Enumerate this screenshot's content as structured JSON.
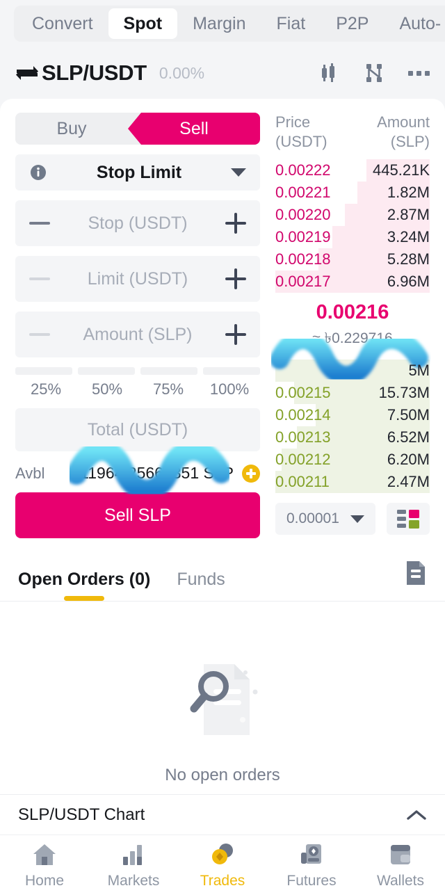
{
  "category_tabs": [
    {
      "label": "Convert",
      "active": false
    },
    {
      "label": "Spot",
      "active": true
    },
    {
      "label": "Margin",
      "active": false
    },
    {
      "label": "Fiat",
      "active": false
    },
    {
      "label": "P2P",
      "active": false
    },
    {
      "label": "Auto-",
      "active": false
    }
  ],
  "pair_header": {
    "pair": "SLP/USDT",
    "change": "0.00%",
    "swap_icon": "swap-arrows-icon",
    "candles_icon": "candlestick-chart-icon",
    "orderbook_icon": "trade-network-icon",
    "more_icon": "more-options-icon"
  },
  "order_form": {
    "buy_label": "Buy",
    "sell_label": "Sell",
    "side_selected": "Sell",
    "order_type": "Stop Limit",
    "info_icon": "info-icon",
    "caret_icon": "chevron-down-icon",
    "stop_placeholder": "Stop (USDT)",
    "limit_placeholder": "Limit (USDT)",
    "amount_placeholder": "Amount (SLP)",
    "total_placeholder": "Total (USDT)",
    "stop_value": "",
    "limit_value": "",
    "amount_value": "",
    "total_value": "",
    "percents": [
      "25%",
      "50%",
      "75%",
      "100%"
    ],
    "avbl_label": "Avbl",
    "avbl_value": "11964.25669351 SLP",
    "avbl_plus_icon": "add-funds-icon",
    "submit_label": "Sell SLP"
  },
  "order_book": {
    "header_price": "Price",
    "header_price_unit": "(USDT)",
    "header_amount": "Amount",
    "header_amount_unit": "(SLP)",
    "asks": [
      {
        "price": "0.00222",
        "amount": "445.21K",
        "depth": 41
      },
      {
        "price": "0.00221",
        "amount": "1.82M",
        "depth": 47
      },
      {
        "price": "0.00220",
        "amount": "2.87M",
        "depth": 55
      },
      {
        "price": "0.00219",
        "amount": "3.24M",
        "depth": 63
      },
      {
        "price": "0.00218",
        "amount": "5.28M",
        "depth": 72
      },
      {
        "price": "0.00217",
        "amount": "6.96M",
        "depth": 100
      }
    ],
    "last_price": "0.00216",
    "last_fiat": "≈ ৳0.229716",
    "bids": [
      {
        "price": "",
        "amount": "5M",
        "depth": 100,
        "redacted": true
      },
      {
        "price": "0.00215",
        "amount": "15.73M",
        "depth": 88
      },
      {
        "price": "0.00214",
        "amount": "7.50M",
        "depth": 74
      },
      {
        "price": "0.00213",
        "amount": "6.52M",
        "depth": 86
      },
      {
        "price": "0.00212",
        "amount": "6.20M",
        "depth": 96
      },
      {
        "price": "0.00211",
        "amount": "2.47M",
        "depth": 100
      }
    ],
    "tick_size": "0.00001",
    "tick_caret_icon": "chevron-down-icon",
    "depth_view_icon": "orderbook-layout-icon"
  },
  "orders_section": {
    "tabs": [
      {
        "label": "Open Orders (0)",
        "active": true
      },
      {
        "label": "Funds",
        "active": false
      }
    ],
    "doc_icon": "order-history-icon",
    "empty_icon": "no-results-icon",
    "empty_text": "No open orders"
  },
  "chart_strip": {
    "title": "SLP/USDT Chart",
    "toggle_icon": "chevron-up-icon"
  },
  "bottom_nav": [
    {
      "label": "Home",
      "icon": "home-icon",
      "active": false
    },
    {
      "label": "Markets",
      "icon": "markets-bars-icon",
      "active": false
    },
    {
      "label": "Trades",
      "icon": "trades-coins-icon",
      "active": true
    },
    {
      "label": "Futures",
      "icon": "futures-icon",
      "active": false
    },
    {
      "label": "Wallets",
      "icon": "wallet-icon",
      "active": false
    }
  ],
  "colors": {
    "sell_pink": "#e8006f",
    "ask_text": "#d1066c",
    "bid_text": "#83a128",
    "accent_gold": "#f0b90b",
    "page_bg": "#f4f5f7"
  },
  "annotations": [
    {
      "name": "scribble-over-sell-button",
      "shape": "blue-wavy-scribble"
    },
    {
      "name": "scribble-over-top-bid-row",
      "shape": "blue-wavy-scribble"
    }
  ]
}
